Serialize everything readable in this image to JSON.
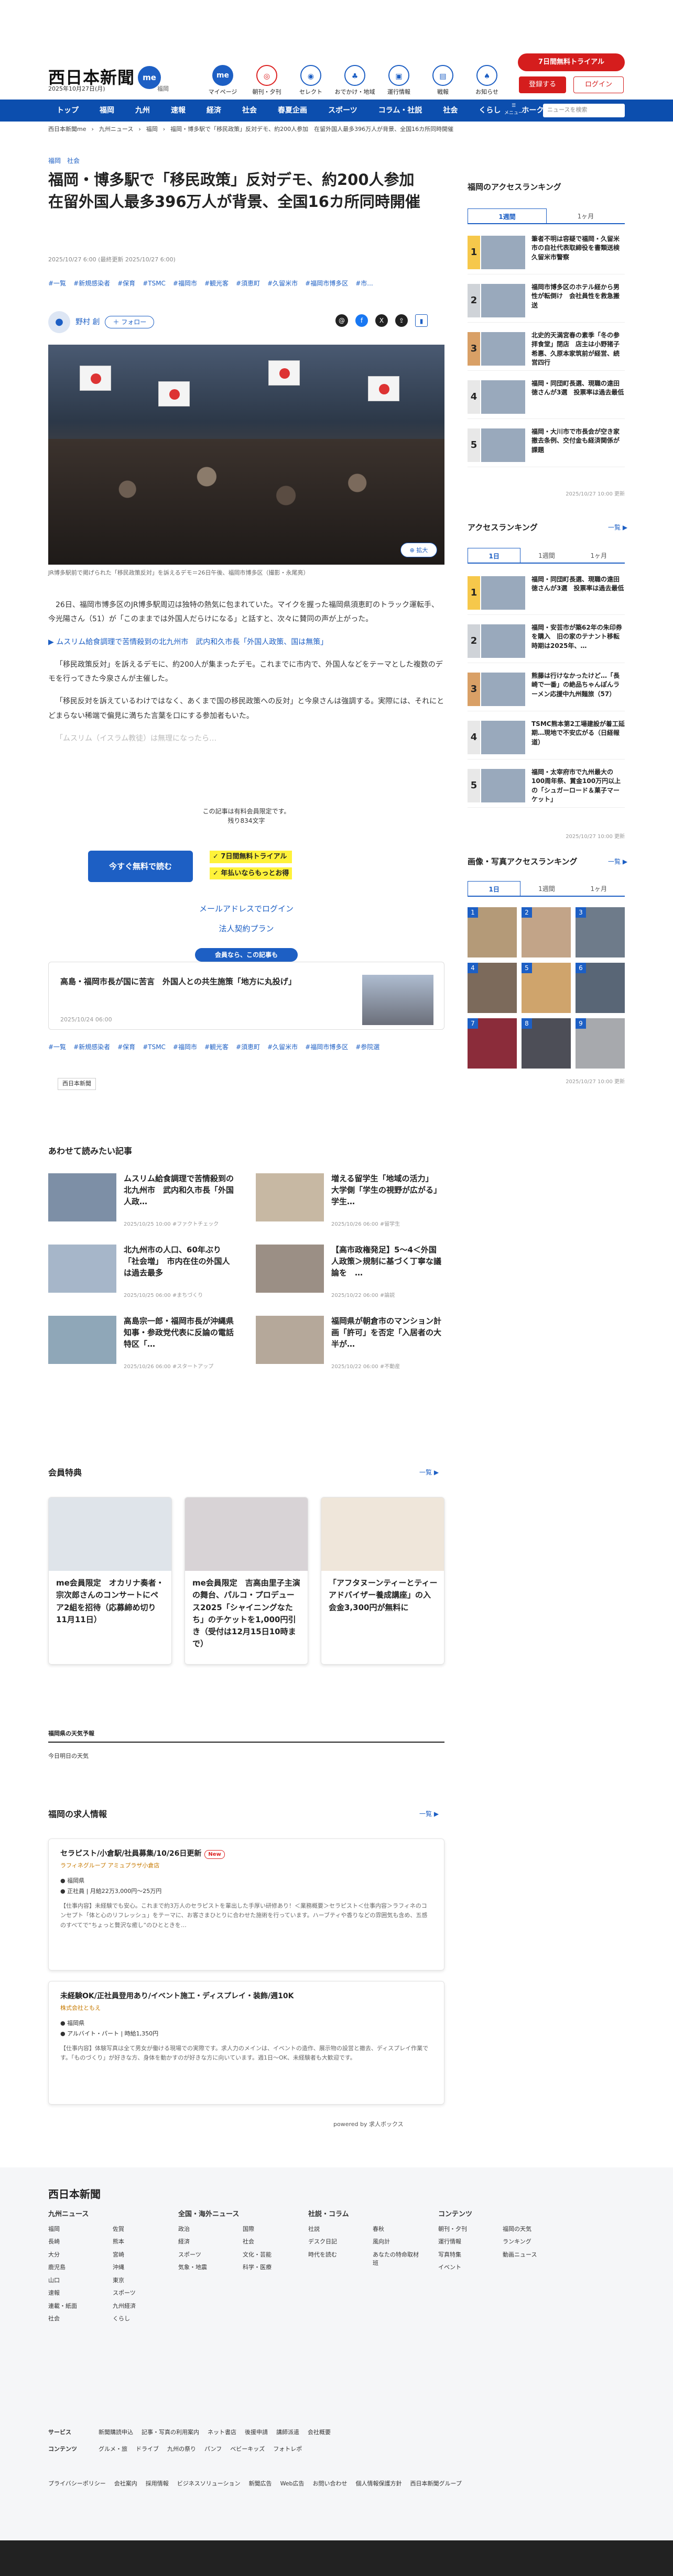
{
  "header": {
    "logo": "西日本新聞",
    "logo_badge": "me",
    "date": "2025年10月27日(月)",
    "area": "福岡",
    "nav": [
      {
        "label": "マイページ",
        "icon": "me"
      },
      {
        "label": "朝刊・夕刊",
        "icon": "◎"
      },
      {
        "label": "セレクト",
        "icon": "◉"
      },
      {
        "label": "おでかけ・地域",
        "icon": "♣"
      },
      {
        "label": "運行情報",
        "icon": "▣"
      },
      {
        "label": "戦報",
        "icon": "▤"
      },
      {
        "label": "お知らせ",
        "icon": "♠"
      }
    ],
    "trial": "7日間無料トライアル",
    "register": "登録する",
    "login": "ログイン"
  },
  "navbar": {
    "items": [
      "トップ",
      "福岡",
      "九州",
      "速報",
      "経済",
      "社会",
      "春夏企画",
      "スポーツ",
      "コラム・社説",
      "社会",
      "くらし",
      "ホークス"
    ],
    "menu": "メニュー",
    "search_placeholder": "ニュースを検索"
  },
  "breadcrumb": [
    "西日本新聞me",
    "九州ニュース",
    "福岡",
    "福岡・博多駅で「移民政策」反対デモ、約200人参加　在留外国人最多396万人が背景、全国16カ所同時開催"
  ],
  "article": {
    "cats": "福岡　社会",
    "title": "福岡・博多駅で「移民政策」反対デモ、約200人参加　在留外国人最多396万人が背景、全国16カ所同時開催",
    "pubdate": "2025/10/27 6:00 (最終更新 2025/10/27 6:00)",
    "tags": [
      "#一覧",
      "#新規感染者",
      "#保育",
      "#TSMC",
      "#福岡市",
      "#観光客",
      "#須恵町",
      "#久留米市",
      "#福岡市博多区",
      "#市..."
    ],
    "author": "野村 創",
    "follow": "＋ フォロー",
    "expand": "⊕ 拡大",
    "caption": "JR博多駅前で掲げられた「移民政策反対」を訴えるデモ＝26日午後、福岡市博多区（撮影・永尾亮）",
    "p1": "26日、福岡市博多区のJR博多駅周辺は独特の熱気に包まれていた。マイクを握った福岡県須恵町のトラック運転手、今光陽さん（51）が「このままでは外国人だらけになる」と話すと、次々に賛同の声が上がった。",
    "link": "▶ ムスリム給食調理で苦情殺到の北九州市　武内和久市長「外国人政策、国は無策」",
    "p2": "「移民政策反対」を訴えるデモに、約200人が集まったデモ。これまでに市内で、外国人などをテーマとした複数のデモを行ってきた今泉さんが主催した。",
    "p3": "「移民反対を訴えているわけではなく、あくまで国の移民政策への反対」と今泉さんは強調する。実際には、それにとどまらない稀端で偏見に満ちた言葉を口にする参加者もいた。",
    "p4": "「ムスリム（イスラム教徒）は無理になったら…"
  },
  "paywall": {
    "t1": "この記事は有料会員限定です。",
    "t2": "残り834文字",
    "button": "今すぐ無料で読む",
    "b1": "✓ 7日間無料トライアル",
    "b2": "✓ 年払いならもっとお得",
    "mail_login": "メールアドレスでログイン",
    "corp": "法人契約プラン",
    "members": "会員なら、この記事も"
  },
  "related_box": {
    "title": "高島・福岡市長が国に苦言　外国人との共生施策「地方に丸投げ」",
    "date": "2025/10/24 06:00"
  },
  "tags2": [
    "#一覧",
    "#新規感染者",
    "#保育",
    "#TSMC",
    "#福岡市",
    "#観光客",
    "#須恵町",
    "#久留米市",
    "#福岡市博多区",
    "#参院選"
  ],
  "source": "西日本新聞",
  "also_read": {
    "heading": "あわせて読みたい記事",
    "items": [
      {
        "title": "ムスリム給食調理で苦情殺到の北九州市　武内和久市長「外国人政…",
        "date": "2025/10/25 10:00  #ファクトチェック"
      },
      {
        "title": "増える留学生「地域の活力」　大学側「学生の視野が広がる」　学生…",
        "date": "2025/10/26 06:00  #留学生"
      },
      {
        "title": "北九州市の人口、60年ぶり「社会増」　市内在住の外国人は過去最多",
        "date": "2025/10/25 06:00  #まちづくり"
      },
      {
        "title": "【高市政権発足】5～4＜外国人政策＞規制に基づく丁寧な議論を　…",
        "date": "2025/10/22 06:00  #論説"
      },
      {
        "title": "高島宗一郎・福岡市長が沖縄県知事・参政党代表に反論の電話　特区「…",
        "date": "2025/10/26 06:00  #スタートアップ"
      },
      {
        "title": "福岡県が朝倉市のマンション計画「許可」を否定「入居者の大半が…",
        "date": "2025/10/22 06:00  #不動産"
      }
    ]
  },
  "members_benefits": {
    "heading": "会員特典",
    "more": "一覧 ▶",
    "items": [
      {
        "title": "me会員限定　オカリナ奏者・宗次郎さんのコンサートにペア2組を招待（応募締め切り11月11日）"
      },
      {
        "title": "me会員限定　吉高由里子主演の舞台、パルコ・プロデュース2025「シャイニングなたち」のチケットを1,000円引き（受付は12月15日10時まで）"
      },
      {
        "title": "「アフタヌーンティーとティーアドバイザー養成講座」の入会金3,300円が無料に"
      }
    ]
  },
  "weather": {
    "heading": "福岡県の天気予報",
    "item": "今日明日の天気"
  },
  "jobs": {
    "heading": "福岡の求人情報",
    "more": "一覧 ▶",
    "items": [
      {
        "title": "セラピスト/小倉駅/社員募集/10/26日更新",
        "new": "New",
        "company": "ラフィネグループ アミュプラザ小倉店",
        "loc": "● 福岡県",
        "pay": "● 正社員 | 月給22万3,000円～25万円",
        "desc": "【仕事内容】未経験でも安心。これまで約3万人のセラピストを輩出した手厚い研修あり！＜業務概要＞セラピスト＜仕事内容＞ラフィネのコンセプト「体と心のリフレッシュ」をテーマに、お客さまひとりに合わせた施術を行っています。ハーブティや香りなどの雰囲気も含め、五感のすべてで“ちょっと贅沢な癒し”のひとときを…"
      },
      {
        "title": "未経験OK/正社員登用あり/イベント施工・ディスプレイ・装飾/週10K",
        "company": "株式会社ともえ",
        "loc": "● 福岡県",
        "pay": "● アルバイト・パート | 時給1,350円",
        "desc": "【仕事内容】体験写真は全て男女が働ける現場での実際です。求人力のメインは、イベントの造作、展示物の設営と撤去、ディスプレイ作業です。「ものづくり」が好きな方、身体を動かすのが好きな方に向いています。週1日～OK、未経験者も大歓迎です。"
      }
    ],
    "sponsor": "powered by 求人ボックス"
  },
  "sidebar": {
    "access_fukuoka": {
      "heading": "福岡のアクセスランキング",
      "tabs": [
        "1週間",
        "1ヶ月"
      ],
      "items": [
        {
          "n": "1",
          "title": "筆者不明は容疑で福岡・久留米市の自社代表取締役を書類送検　久留米市警察"
        },
        {
          "n": "2",
          "title": "福岡市博多区のホテル経から男性が転倒け　会社員性を救急搬送"
        },
        {
          "n": "3",
          "title": "北史的天満宮春の素季「冬の参拝食堂」閉店　店主は小野猪子希惠、久原本家筑前が経営、続営四行"
        },
        {
          "n": "4",
          "title": "福岡・同団町長選、現職の遠田徳さんが3選　投票率は過去最低"
        },
        {
          "n": "5",
          "title": "福岡・大川市で市長会が空き家撤去条例、交付金も経済関係が課題"
        }
      ],
      "date": "2025/10/27 10:00 更新"
    },
    "access": {
      "heading": "アクセスランキング",
      "more": "一覧 ▶",
      "tabs": [
        "1日",
        "1週間",
        "1ヶ月"
      ],
      "items": [
        {
          "n": "1",
          "title": "福岡・同団町長選、現職の遠田徳さんが3選　投票率は過去最低"
        },
        {
          "n": "2",
          "title": "福岡・安芸市が築62年の朱印券を購入　旧の家のテナント移転時期は2025年、…"
        },
        {
          "n": "3",
          "title": "熊藤は行けなかったけど…「長崎で一番」の絶品ちゃんぽんラーメン応援中九州麺旅（57）"
        },
        {
          "n": "4",
          "title": "TSMC熊本第2工場建設が着工延期…現地で不安広がる（日経報道）"
        },
        {
          "n": "5",
          "title": "福岡・太宰府市で九州最大の100周年祭、賞金100万円以上の「シュガーロード＆菓子マーケット」"
        }
      ],
      "date": "2025/10/27 10:00 更新"
    },
    "photo": {
      "heading": "画像・写真アクセスランキング",
      "more": "一覧 ▶",
      "tabs": [
        "1日",
        "1週間",
        "1ヶ月"
      ],
      "date": "2025/10/27 10:00 更新"
    }
  },
  "footer": {
    "logo": "西日本新聞",
    "cols": [
      {
        "h": "九州ニュース",
        "items": [
          "福岡",
          "佐賀",
          "長崎",
          "熊本",
          "大分",
          "宮崎",
          "鹿児島",
          "沖縄",
          "山口",
          "東京",
          "速報",
          "スポーツ",
          "連載・紙面",
          "九州経済",
          "社会",
          "くらし"
        ]
      },
      {
        "h": "全国・海外ニュース",
        "items": [
          "政治",
          "国際",
          "経済",
          "社会",
          "スポーツ",
          "文化・芸能",
          "気象・地震",
          "科学・医療"
        ]
      },
      {
        "h": "社説・コラム",
        "items": [
          "社説",
          "春秋",
          "デスク日記",
          "風向計",
          "時代を読む",
          "あなたの特命取材班"
        ]
      },
      {
        "h": "コンテンツ",
        "items": [
          "朝刊・夕刊",
          "福岡の天気",
          "運行情報",
          "ランキング",
          "写真特集",
          "動画ニュース",
          "イベント"
        ]
      }
    ],
    "service": [
      "新聞購読申込",
      "記事・写真の利用案内",
      "ネット書店",
      "後援申請",
      "講師派遣",
      "会社概要"
    ],
    "contents": [
      "グルメ・旅",
      "ドライブ",
      "九州の祭り",
      "パンフ",
      "ベビーキッズ",
      "フォトレポ"
    ],
    "links": [
      "プライバシーポリシー",
      "会社案内",
      "採用情報",
      "ビジネスソリューション",
      "新聞広告",
      "Web広告",
      "お問い合わせ",
      "個人情報保護方針",
      "西日本新聞グループ"
    ]
  }
}
